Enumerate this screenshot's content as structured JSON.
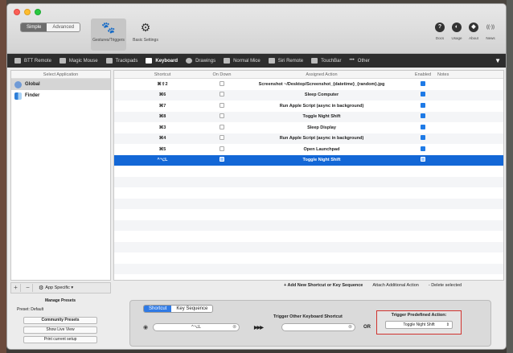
{
  "window": {
    "mode_tabs": [
      "Simple",
      "Advanced"
    ],
    "toolbar": [
      {
        "label": "Gestures/Triggers",
        "icon": "paw-icon"
      },
      {
        "label": "Basic Settings",
        "icon": "gear-icon"
      }
    ],
    "right_icons": [
      {
        "label": "Docs",
        "icon": "help-icon",
        "glyph": "?"
      },
      {
        "label": "Usage",
        "icon": "pie-chart-icon",
        "glyph": "◐"
      },
      {
        "label": "About",
        "icon": "tag-icon",
        "glyph": "◆"
      },
      {
        "label": "News",
        "icon": "broadcast-icon",
        "glyph": "((·))"
      }
    ]
  },
  "tabs": [
    {
      "label": "BTT Remote"
    },
    {
      "label": "Magic Mouse"
    },
    {
      "label": "Trackpads"
    },
    {
      "label": "Keyboard"
    },
    {
      "label": "Drawings"
    },
    {
      "label": "Normal Mice"
    },
    {
      "label": "Siri Remote"
    },
    {
      "label": "TouchBar"
    },
    {
      "label": "Other"
    }
  ],
  "left_pane": {
    "header": "Select Application",
    "apps": [
      {
        "name": "Global"
      },
      {
        "name": "Finder"
      }
    ],
    "add": "+",
    "remove": "−",
    "app_specific": "App Specific ▾"
  },
  "table": {
    "columns": {
      "shortcut": "Shortcut",
      "on_down": "On Down",
      "action": "Assigned Action",
      "enabled": "Enabled",
      "notes": "Notes"
    },
    "rows": [
      {
        "shortcut": "⌘⇧2",
        "on_down": false,
        "action": "Screenshot ~/Desktop/Screenshot_{datetime}_{random}.jpg",
        "enabled": true
      },
      {
        "shortcut": "⌘6",
        "on_down": false,
        "action": "Sleep Computer",
        "enabled": true
      },
      {
        "shortcut": "⌘7",
        "on_down": false,
        "action": "Run Apple Script (async in background)",
        "enabled": true
      },
      {
        "shortcut": "⌘8",
        "on_down": false,
        "action": "Toggle Night Shift",
        "enabled": true
      },
      {
        "shortcut": "⌘3",
        "on_down": false,
        "action": "Sleep Display",
        "enabled": true
      },
      {
        "shortcut": "⌘4",
        "on_down": false,
        "action": "Run Apple Script (async in background)",
        "enabled": true
      },
      {
        "shortcut": "⌘5",
        "on_down": false,
        "action": "Open Launchpad",
        "enabled": true
      },
      {
        "shortcut": "^⌥L",
        "on_down": true,
        "action": "Toggle Night Shift",
        "enabled": true
      }
    ]
  },
  "actions": {
    "add": "+ Add New Shortcut or Key Sequence",
    "attach": "Attach Additional Action",
    "delete": "- Delete selected"
  },
  "presets": {
    "manage": "Manage Presets",
    "preset_label": "Preset: Default",
    "community": "Community Presets",
    "live_view": "Show Live View",
    "print": "Print current setup"
  },
  "config": {
    "tabs": [
      "Shortcut",
      "Key Sequence"
    ],
    "recorded": "^⌥L",
    "arrows": "▶▶▶",
    "other_label": "Trigger Other Keyboard Shortcut",
    "or": "OR",
    "predefined_label": "Trigger Predefined Action:",
    "predefined_value": "Toggle Night Shift"
  }
}
